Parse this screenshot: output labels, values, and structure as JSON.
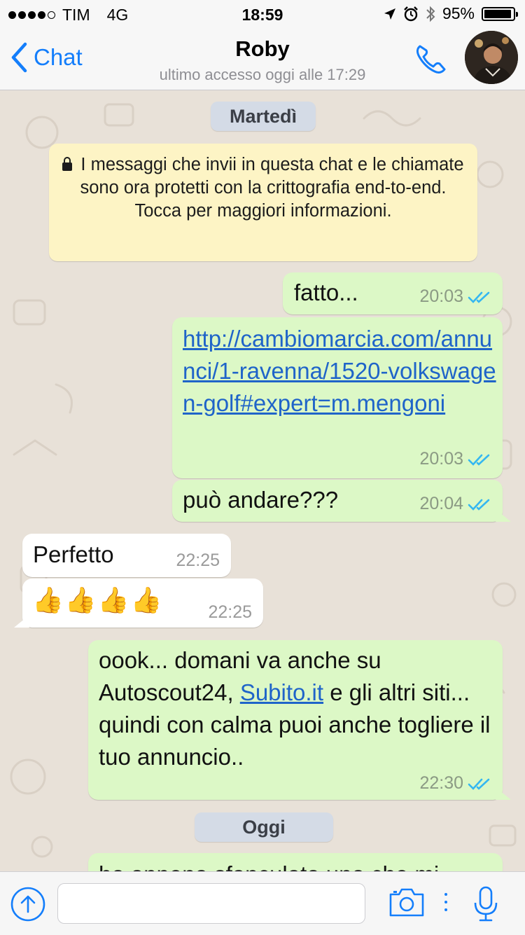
{
  "status_bar": {
    "carrier": "TIM",
    "network": "4G",
    "time": "18:59",
    "battery": "95%",
    "battery_level": 0.95,
    "signal_bars": 4
  },
  "nav": {
    "back_label": "Chat",
    "contact_name": "Roby",
    "last_seen": "ultimo accesso oggi alle 17:29",
    "icons": [
      "chevron-left-icon",
      "phone-icon",
      "avatar"
    ]
  },
  "chat": {
    "date_1": "Martedì",
    "encryption_notice": "I messaggi che invii in questa chat e le chiamate sono ora protetti con la crittografia end-to-end. Tocca per maggiori informazioni.",
    "messages": [
      {
        "direction": "out",
        "text": "fatto...",
        "time": "20:03",
        "read": true
      },
      {
        "direction": "out",
        "text": "http://cambiomarcia.com/annunci/1-ravenna/1520-volkswagen-golf#expert=m.mengoni",
        "time": "20:03",
        "read": true
      },
      {
        "direction": "out",
        "text": "può andare???",
        "time": "20:04",
        "read": true
      },
      {
        "direction": "in",
        "text": "Perfetto",
        "time": "22:25"
      },
      {
        "direction": "in",
        "text": "👍👍👍👍",
        "time": "22:25"
      },
      {
        "direction": "out",
        "text_before": "oook... domani va anche su Autoscout24, ",
        "link": "Subito.it",
        "text_after": " e gli altri siti... quindi con calma puoi anche togliere il tuo annuncio..",
        "time": "22:30",
        "read": true
      },
      {
        "direction": "out",
        "text": "ho appena sfanculato uno che mi",
        "partial": true
      }
    ],
    "date_2": "Oggi"
  },
  "input_bar": {
    "placeholder": "",
    "icons": [
      "upload-icon",
      "camera-icon",
      "more-dots-icon",
      "microphone-icon"
    ]
  },
  "colors": {
    "accent": "#147efb",
    "outgoing_bubble": "#dcf8c6",
    "incoming_bubble": "#ffffff",
    "notice_bg": "#fdf4c5",
    "date_pill": "#d4dbe6",
    "read_ticks": "#34b7f1"
  }
}
